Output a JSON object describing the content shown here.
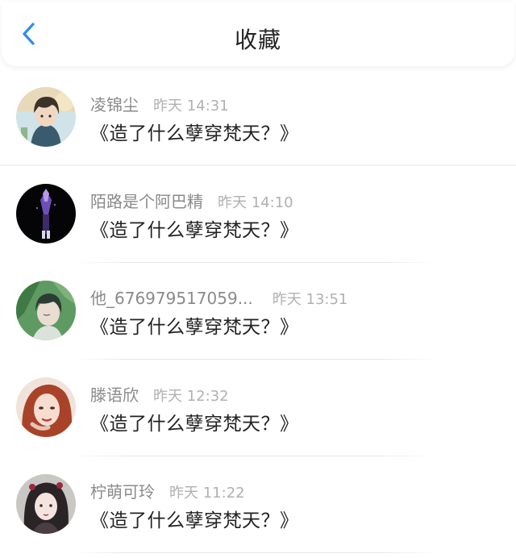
{
  "header": {
    "title": "收藏",
    "back_icon": "chevron-left-icon",
    "accent_color": "#2d8cf0"
  },
  "items": [
    {
      "name": "凌锦尘",
      "time": "昨天 14:31",
      "content": "《造了什么孽穿梵天？》"
    },
    {
      "name": "陌路是个阿巴精",
      "time": "昨天 14:10",
      "content": "《造了什么孽穿梵天？》"
    },
    {
      "name": "他_676979517059...",
      "time": "昨天 13:51",
      "content": "《造了什么孽穿梵天？》"
    },
    {
      "name": "滕语欣",
      "time": "昨天 12:32",
      "content": "《造了什么孽穿梵天？》"
    },
    {
      "name": "柠萌可玲",
      "time": "昨天 11:22",
      "content": "《造了什么孽穿梵天？》"
    }
  ]
}
